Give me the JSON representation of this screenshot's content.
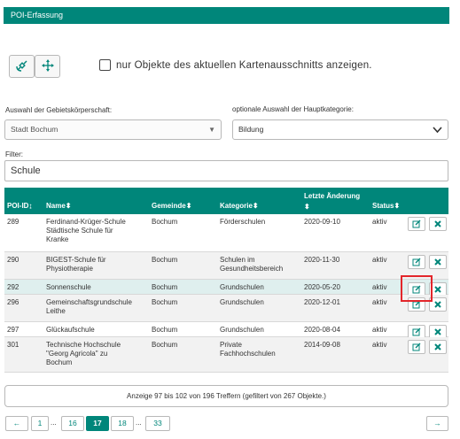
{
  "header": {
    "title": "POI-Erfassung"
  },
  "tools": {
    "left_icon": "satellite-icon",
    "right_icon": "move-arrows-icon"
  },
  "checkbox": {
    "label": "nur Objekte des aktuellen Kartenausschnitts anzeigen.",
    "checked": false
  },
  "filters": {
    "authority_label": "Auswahl der Gebietskörperschaft:",
    "authority_value": "Stadt Bochum",
    "category_label": "optionale Auswahl der Hauptkategorie:",
    "category_value": "Bildung",
    "filter_label": "Filter:",
    "filter_value": "Schule"
  },
  "table": {
    "columns": {
      "id": "POI-ID",
      "name": "Name",
      "gemeinde": "Gemeinde",
      "kategorie": "Kategorie",
      "aenderung_line1": "Letzte Änderung",
      "status": "Status"
    },
    "sort_icon": "⬍",
    "rows": [
      {
        "id": "289",
        "name_lines": [
          "Ferdinand-Krüger-Schule",
          "Städtische Schule für",
          "Kranke"
        ],
        "gemeinde": "Bochum",
        "kategorie_lines": [
          "Förderschulen"
        ],
        "datum": "2020-09-10",
        "status": "aktiv"
      },
      {
        "id": "290",
        "name_lines": [
          "BIGEST-Schule für",
          "Physiotherapie"
        ],
        "gemeinde": "Bochum",
        "kategorie_lines": [
          "Schulen im",
          "Gesundheitsbereich"
        ],
        "datum": "2020-11-30",
        "status": "aktiv"
      },
      {
        "id": "292",
        "name_lines": [
          "Sonnenschule"
        ],
        "gemeinde": "Bochum",
        "kategorie_lines": [
          "Grundschulen"
        ],
        "datum": "2020-05-20",
        "status": "aktiv"
      },
      {
        "id": "296",
        "name_lines": [
          "Gemeinschaftsgrundschule",
          "Leithe"
        ],
        "gemeinde": "Bochum",
        "kategorie_lines": [
          "Grundschulen"
        ],
        "datum": "2020-12-01",
        "status": "aktiv"
      },
      {
        "id": "297",
        "name_lines": [
          "Glückaufschule"
        ],
        "gemeinde": "Bochum",
        "kategorie_lines": [
          "Grundschulen"
        ],
        "datum": "2020-08-04",
        "status": "aktiv"
      },
      {
        "id": "301",
        "name_lines": [
          "Technische Hochschule",
          "\"Georg Agricola\" zu",
          "Bochum"
        ],
        "gemeinde": "Bochum",
        "kategorie_lines": [
          "Private",
          "Fachhochschulen"
        ],
        "datum": "2014-09-08",
        "status": "aktiv"
      }
    ]
  },
  "info": "Anzeige 97 bis 102 von 196 Treffern (gefiltert von 267 Objekte.)",
  "pagination": {
    "prev": "←",
    "next": "→",
    "pages": [
      "1",
      "16",
      "17",
      "18",
      "33"
    ],
    "active": "17",
    "ellipsis": "..."
  },
  "colors": {
    "accent": "#00867a",
    "highlight": "#e3262b"
  }
}
